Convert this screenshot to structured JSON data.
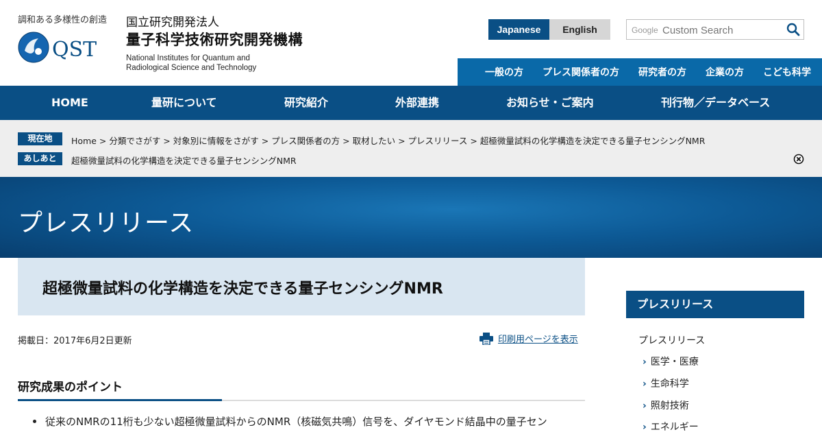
{
  "header": {
    "tagline": "調和ある多様性の創造",
    "logo_text": "QST",
    "org_small": "国立研究開発法人",
    "org_big": "量子科学技術研究開発機構",
    "org_en_line1": "National Institutes for Quantum and",
    "org_en_line2": "Radiological Science and Technology"
  },
  "language": {
    "japanese": "Japanese",
    "english": "English"
  },
  "search": {
    "brand": "Google",
    "placeholder": "Custom Search"
  },
  "audience_nav": [
    "一般の方",
    "プレス関係者の方",
    "研究者の方",
    "企業の方",
    "こども科学"
  ],
  "global_nav": [
    "HOME",
    "量研について",
    "研究紹介",
    "外部連携",
    "お知らせ・ご案内",
    "刊行物／データベース"
  ],
  "breadcrumb": {
    "current_tag": "現在地",
    "current_path": "Home > 分類でさがす > 対象別に情報をさがす > プレス関係者の方 > 取材したい > プレスリリース > 超極微量試料の化学構造を決定できる量子センシングNMR",
    "history_tag": "あしあと",
    "history_path": "超極微量試料の化学構造を決定できる量子センシングNMR"
  },
  "banner_title": "プレスリリース",
  "article": {
    "title": "超極微量試料の化学構造を決定できる量子センシングNMR",
    "date": "掲載日：2017年6月2日更新",
    "print_label": "印刷用ページを表示",
    "section_heading": "研究成果のポイント",
    "bullet_1": "従来のNMRの11桁も少ない超極微量試料からのNMR（核磁気共鳴）信号を、ダイヤモンド結晶中の量子セン"
  },
  "sidebar": {
    "heading": "プレスリリース",
    "top_item": "プレスリリース",
    "items": [
      "医学・医療",
      "生命科学",
      "照射技術",
      "エネルギー"
    ]
  },
  "colors": {
    "navy": "#0a4f85",
    "blue": "#0a69a8",
    "light_blue": "#d9e6f1"
  }
}
